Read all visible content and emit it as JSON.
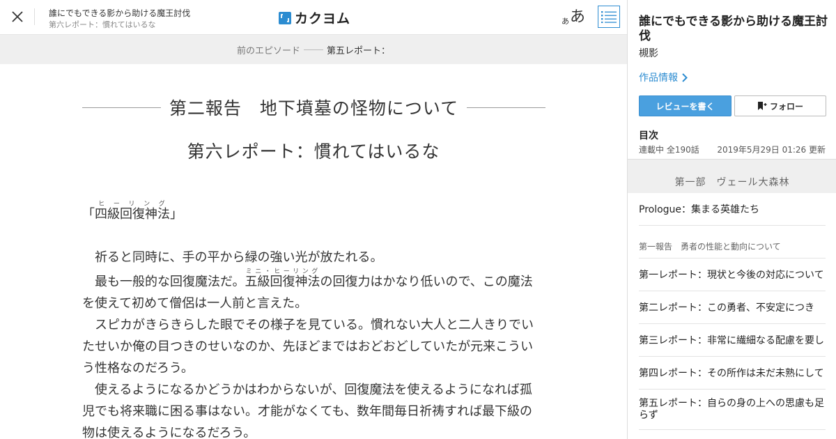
{
  "header": {
    "work_title": "誰にでもできる影から助ける魔王討伐",
    "episode_subtitle": "第六レポート：慣れてはいるな",
    "logo_text": "カクヨム",
    "font_small": "あ",
    "font_big": "あ",
    "icons": {
      "close": "close-icon",
      "toc": "list-icon"
    }
  },
  "nav": {
    "prev_label": "前のエピソード",
    "current_label": "第五レポート："
  },
  "reader": {
    "chapter_title": "第二報告　地下墳墓の怪物について",
    "episode_title": "第六レポート：慣れてはいるな",
    "spell_open": "「",
    "spell_base": "四級回復神法",
    "spell_ruby": "ヒーリング",
    "spell_close": "」",
    "p1": "祈ると同時に、手の平から緑の強い光が放たれる。",
    "p2_pre": "最も一般的な回復魔法だ。",
    "p2_ruby_base": "五級回復神法",
    "p2_ruby": "ミニ・ヒーリング",
    "p2_post": "の回復力はかなり低いので、この魔法を使えて初めて僧侶は一人前と言えた。",
    "p3": "スピカがきらきらした眼でその様子を見ている。慣れない大人と二人きりでいたせいか俺の目つきのせいなのか、先ほどまではおどおどしていたが元来こういう性格なのだろう。",
    "p4": "使えるようになるかどうかはわからないが、回復魔法を使えるようになれば孤児でも将来職に困る事はない。才能がなくても、数年間毎日祈祷すれば最下級の物は使えるようになるだろう。"
  },
  "sidebar": {
    "title": "誰にでもできる影から助ける魔王討伐",
    "author": "槻影",
    "info_link": "作品情報",
    "review_button": "レビューを書く",
    "follow_button": "フォロー",
    "toc_label": "目次",
    "status": "連載中 全190話",
    "updated": "2019年5月29日 01:26 更新",
    "part_title": "第一部　ヴェール大森林",
    "prologue": "Prologue：集まる英雄たち",
    "chapter1": "第一報告　勇者の性能と動向について",
    "episodes": [
      "第一レポート：現状と今後の対応について",
      "第二レポート：この勇者、不安定につき",
      "第三レポート：非常に繊細なる配慮を要し",
      "第四レポート：その所作は未だ未熟にして",
      "第五レポート：自らの身の上への思慮も足らず"
    ]
  },
  "colors": {
    "accent": "#2c8cd1",
    "review_bg": "#4aa0df",
    "nav_bg": "#efefef"
  }
}
